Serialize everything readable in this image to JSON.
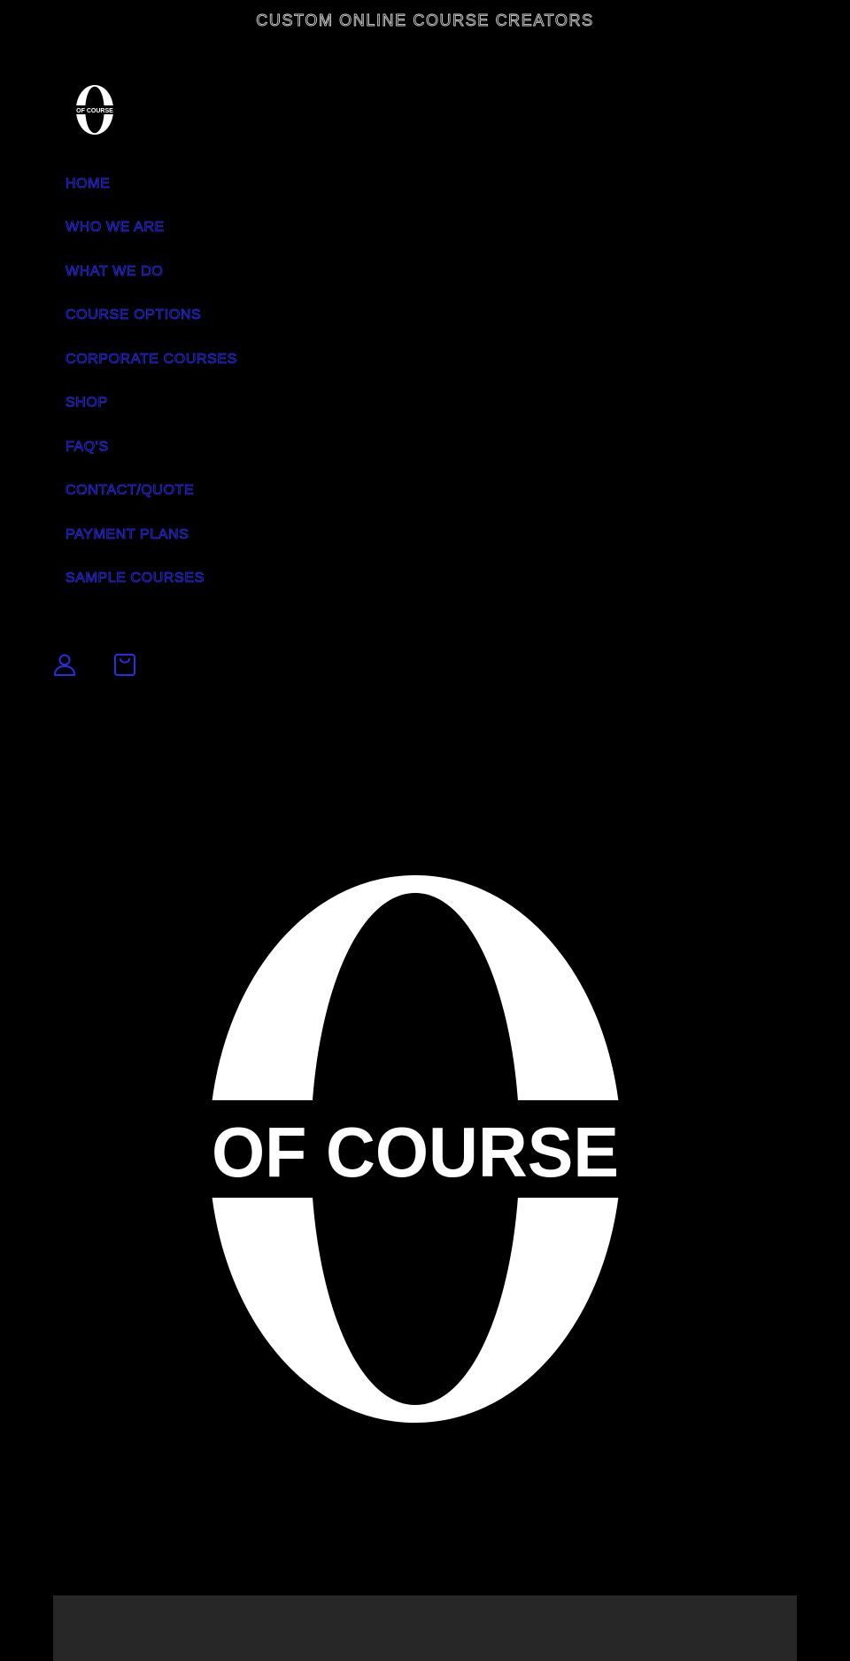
{
  "announcement": {
    "text": "CUSTOM ONLINE COURSE CREATORS"
  },
  "brand": {
    "logo_text": "OF COURSE",
    "logo_icon": "of-course-logo"
  },
  "nav": {
    "items": [
      {
        "label": "HOME"
      },
      {
        "label": "WHO WE ARE"
      },
      {
        "label": "WHAT WE DO"
      },
      {
        "label": "COURSE OPTIONS"
      },
      {
        "label": "CORPORATE COURSES"
      },
      {
        "label": "SHOP"
      },
      {
        "label": "FAQ'S"
      },
      {
        "label": "CONTACT/QUOTE"
      },
      {
        "label": "PAYMENT PLANS"
      },
      {
        "label": "SAMPLE COURSES"
      }
    ]
  },
  "header_icons": {
    "account": "account-icon",
    "cart": "cart-icon"
  },
  "hero": {
    "logo_text": "OF COURSE"
  },
  "colors": {
    "background": "#000000",
    "nav_link": "#2b2be0",
    "logo": "#ffffff",
    "panel": "#272727"
  }
}
